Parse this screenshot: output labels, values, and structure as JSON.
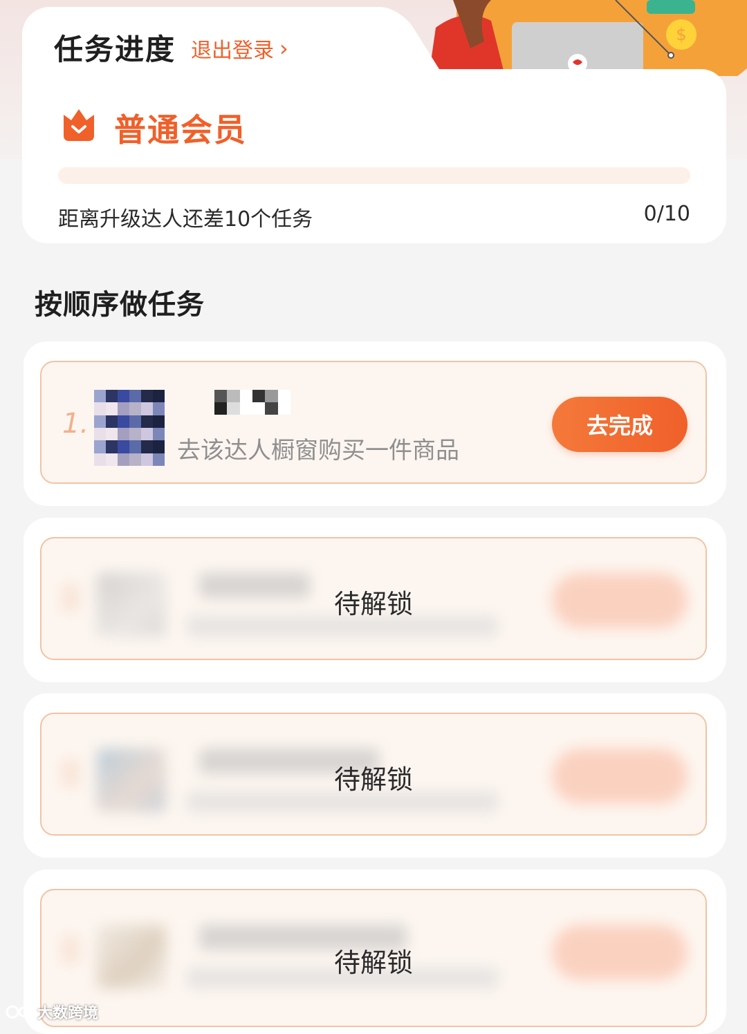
{
  "header": {
    "title": "任务进度",
    "logout_label": "退出登录",
    "chevron": "›"
  },
  "membership": {
    "icon": "crown-shield-icon",
    "level_name": "普通会员",
    "upgrade_text": "距离升级达人还差10个任务",
    "progress_text": "0/10",
    "progress_fraction": 0
  },
  "section": {
    "title": "按顺序做任务"
  },
  "tasks": [
    {
      "number": "1.",
      "description": "去该达人橱窗购买一件商品",
      "button_label": "去完成",
      "locked": false
    },
    {
      "lock_label": "待解锁",
      "locked": true
    },
    {
      "lock_label": "待解锁",
      "locked": true
    },
    {
      "lock_label": "待解锁",
      "locked": true
    }
  ],
  "watermark": {
    "text": "大数跨境"
  },
  "colors": {
    "accent": "#f0602a",
    "card_border": "#f3c2a4",
    "card_fill": "#fdf6f0",
    "background": "#f4f4f4"
  }
}
